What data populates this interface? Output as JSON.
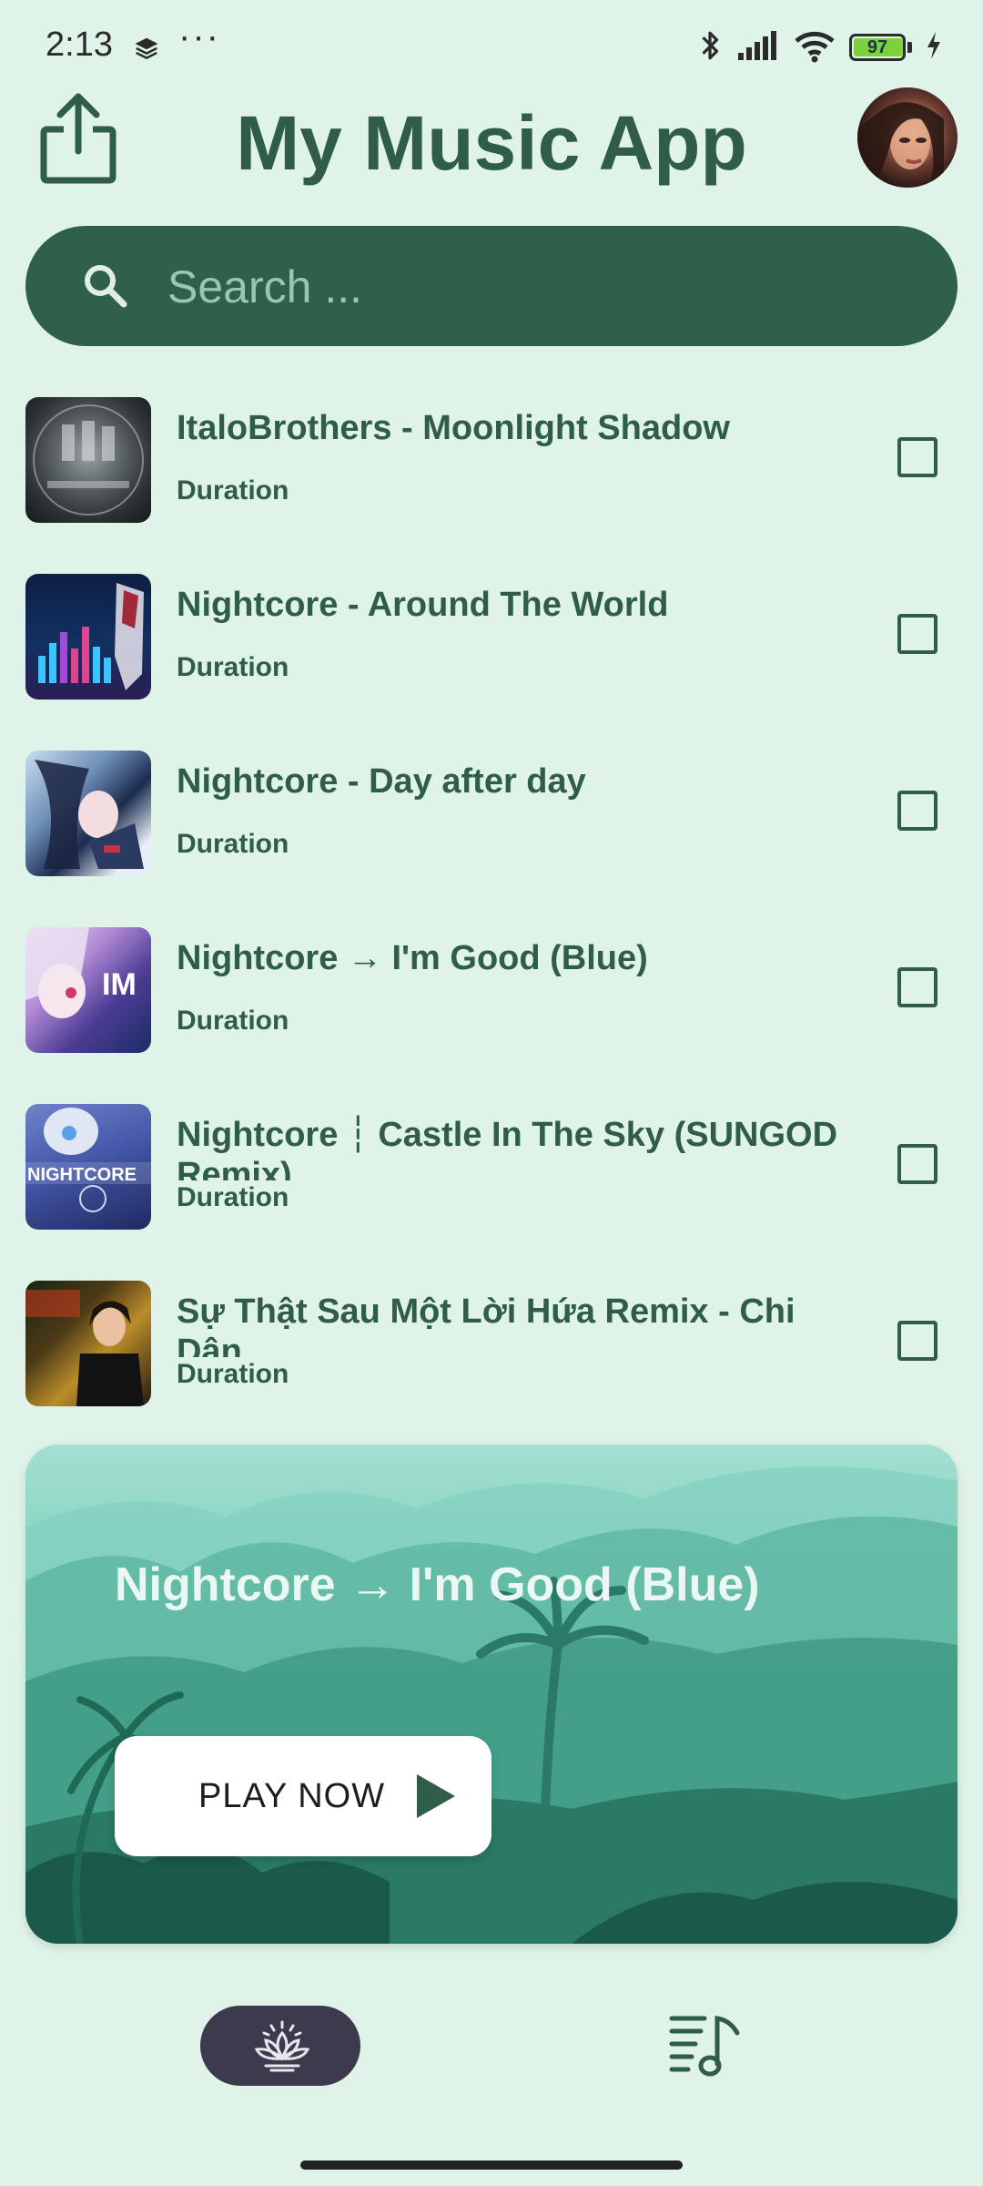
{
  "status_bar": {
    "time": "2:13",
    "dots": "···",
    "battery": "97"
  },
  "header": {
    "title": "My Music App"
  },
  "search": {
    "placeholder": "Search ..."
  },
  "songs": [
    {
      "title": "ItaloBrothers - Moonlight Shadow",
      "duration": "Duration"
    },
    {
      "title": "Nightcore - Around The World",
      "duration": "Duration"
    },
    {
      "title": "Nightcore - Day after day",
      "duration": "Duration"
    },
    {
      "title": "Nightcore → I'm Good (Blue)",
      "duration": "Duration"
    },
    {
      "title": "Nightcore ┆ Castle In The Sky (SUNGOD Remix)",
      "duration": "Duration"
    },
    {
      "title": "Sự Thật Sau Một Lời Hứa Remix - Chi Dân",
      "duration": "Duration"
    }
  ],
  "now_playing": {
    "title": "Nightcore → I'm Good (Blue)",
    "play_label": "PLAY NOW"
  },
  "colors": {
    "background": "#dff3e9",
    "primary": "#2f614a",
    "nav_active": "#3c3a4c"
  }
}
